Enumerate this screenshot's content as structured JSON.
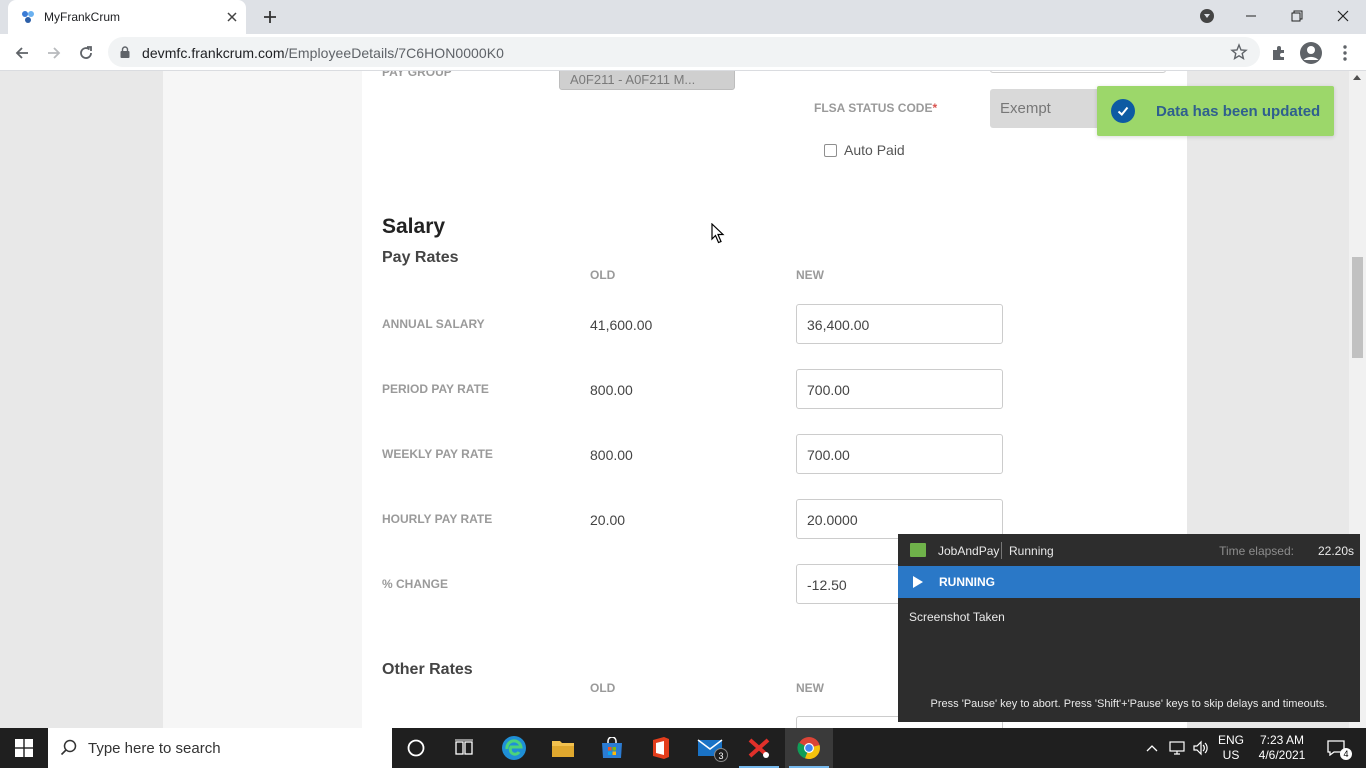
{
  "browser": {
    "tab_title": "MyFrankCrum",
    "url_domain": "devmfc.frankcrum.com",
    "url_path": "/EmployeeDetails/7C6HON0000K0"
  },
  "form": {
    "pay_group_label": "PAY GROUP",
    "pay_group_value": "A0F211 - A0F211 M...",
    "flsa_label": "FLSA STATUS CODE",
    "flsa_required": "*",
    "flsa_value": "Exempt",
    "auto_paid_label": "Auto Paid",
    "auto_paid_checked": false
  },
  "salary": {
    "heading": "Salary",
    "pay_rates_heading": "Pay Rates",
    "col_old": "OLD",
    "col_new": "NEW",
    "rows": [
      {
        "label": "ANNUAL SALARY",
        "old": "41,600.00",
        "new": "36,400.00"
      },
      {
        "label": "PERIOD PAY RATE",
        "old": "800.00",
        "new": "700.00"
      },
      {
        "label": "WEEKLY PAY RATE",
        "old": "800.00",
        "new": "700.00"
      },
      {
        "label": "HOURLY PAY RATE",
        "old": "20.00",
        "new": "20.0000"
      },
      {
        "label": "% CHANGE",
        "old": "",
        "new": "-12.50"
      }
    ],
    "other_rates_heading": "Other Rates",
    "other_col_old": "OLD",
    "other_col_new": "NEW"
  },
  "toast": {
    "message": "Data has been updated",
    "color": "#9cd76a"
  },
  "runner": {
    "name": "JobAndPay",
    "state": "Running",
    "elapsed_label": "Time elapsed:",
    "elapsed": "22.20s",
    "status": "RUNNING",
    "log": "Screenshot Taken",
    "footer": "Press 'Pause' key to abort. Press 'Shift'+'Pause' keys to skip delays and timeouts.",
    "bar_color": "#2a78c7"
  },
  "taskbar": {
    "search_placeholder": "Type here to search",
    "mail_count": "3",
    "lang_top": "ENG",
    "lang_bottom": "US",
    "time": "7:23 AM",
    "date": "4/6/2021",
    "notification_count": "4"
  },
  "icons": [
    "frankcrum-favicon-icon",
    "close-icon",
    "plus-icon",
    "back-icon",
    "forward-icon",
    "reload-icon",
    "lock-icon",
    "star-icon",
    "extensions-icon",
    "profile-icon",
    "menu-icon",
    "check-icon",
    "windows-icon",
    "search-icon",
    "cortana-icon",
    "task-view-icon",
    "edge-icon",
    "file-explorer-icon",
    "store-icon",
    "office-icon",
    "mail-icon",
    "app-icon",
    "chrome-icon"
  ]
}
